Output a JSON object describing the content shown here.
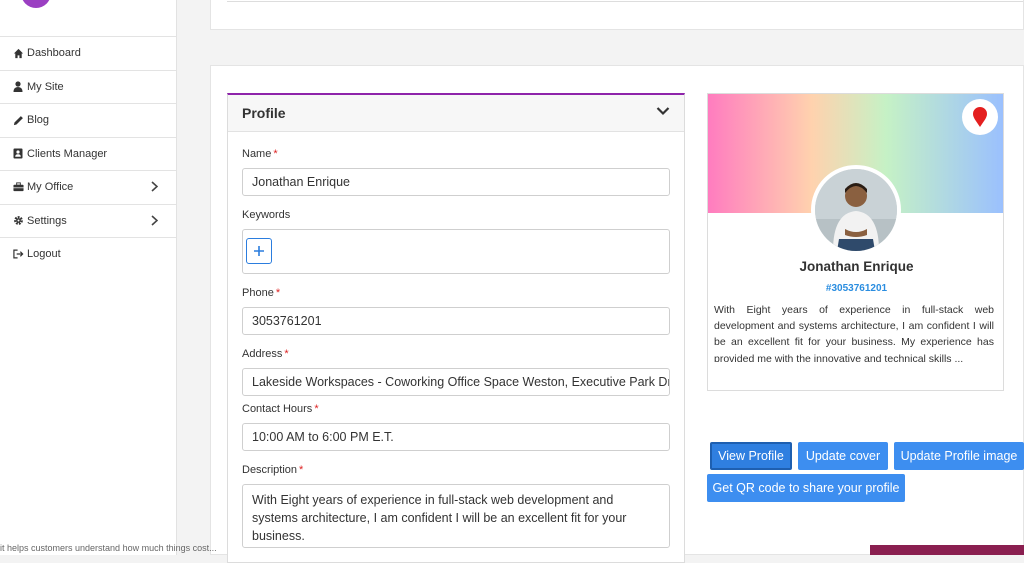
{
  "sidebar": {
    "items": [
      {
        "label": "Dashboard",
        "icon": "home-icon",
        "has_submenu": false
      },
      {
        "label": "My Site",
        "icon": "user-icon",
        "has_submenu": false
      },
      {
        "label": "Blog",
        "icon": "pencil-icon",
        "has_submenu": false
      },
      {
        "label": "Clients Manager",
        "icon": "address-book-icon",
        "has_submenu": false
      },
      {
        "label": "My Office",
        "icon": "briefcase-icon",
        "has_submenu": true
      },
      {
        "label": "Settings",
        "icon": "gear-icon",
        "has_submenu": true
      },
      {
        "label": "Logout",
        "icon": "logout-icon",
        "has_submenu": false
      }
    ]
  },
  "profile_form": {
    "title": "Profile",
    "fields": {
      "name": {
        "label": "Name",
        "required": true,
        "value": "Jonathan Enrique"
      },
      "keywords": {
        "label": "Keywords",
        "required": false
      },
      "phone": {
        "label": "Phone",
        "required": true,
        "value": "3053761201"
      },
      "address": {
        "label": "Address",
        "required": true,
        "value": "Lakeside Workspaces - Coworking Office Space Weston, Executive Park Driv"
      },
      "contact_hours": {
        "label": "Contact Hours",
        "required": true,
        "value": "10:00 AM to 6:00 PM E.T."
      },
      "description": {
        "label": "Description",
        "required": true,
        "value": "With Eight years of experience in full-stack web development and systems architecture, I am confident I will be an excellent fit for your business.\nMy experience has provided me with the innovative and technical skills"
      }
    },
    "required_marker": "*"
  },
  "profile_card": {
    "name": "Jonathan Enrique",
    "phone_tag": "#3053761201",
    "bio": "With Eight years of experience in full-stack web development and systems architecture, I am confident I will be an excellent fit for your business. My experience has provided me with the innovative and technical skills ...",
    "accent_color": "#6d1898",
    "social": [
      "instagram-icon",
      "linkedin-icon"
    ]
  },
  "actions": {
    "view_profile": "View Profile",
    "update_cover": "Update cover",
    "update_profile_image": "Update Profile image",
    "get_qr": "Get QR code to share your profile"
  },
  "footer_snippet": "it helps customers understand how much things cost..."
}
